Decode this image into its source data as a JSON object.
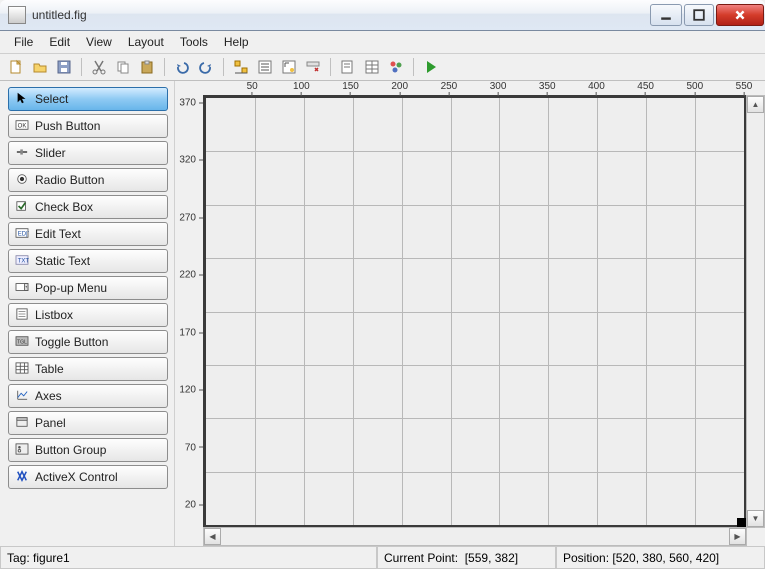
{
  "title": "untitled.fig",
  "menus": [
    "File",
    "Edit",
    "View",
    "Layout",
    "Tools",
    "Help"
  ],
  "palette": [
    {
      "label": "Select",
      "icon": "cursor",
      "selected": true
    },
    {
      "label": "Push Button",
      "icon": "ok-box",
      "selected": false
    },
    {
      "label": "Slider",
      "icon": "slider",
      "selected": false
    },
    {
      "label": "Radio Button",
      "icon": "radio",
      "selected": false
    },
    {
      "label": "Check Box",
      "icon": "checkbox",
      "selected": false
    },
    {
      "label": "Edit Text",
      "icon": "edit-text",
      "selected": false
    },
    {
      "label": "Static Text",
      "icon": "static-text",
      "selected": false
    },
    {
      "label": "Pop-up Menu",
      "icon": "popup",
      "selected": false
    },
    {
      "label": "Listbox",
      "icon": "listbox",
      "selected": false
    },
    {
      "label": "Toggle Button",
      "icon": "toggle",
      "selected": false
    },
    {
      "label": "Table",
      "icon": "table",
      "selected": false
    },
    {
      "label": "Axes",
      "icon": "axes",
      "selected": false
    },
    {
      "label": "Panel",
      "icon": "panel",
      "selected": false
    },
    {
      "label": "Button Group",
      "icon": "btn-group",
      "selected": false
    },
    {
      "label": "ActiveX Control",
      "icon": "activex",
      "selected": false
    }
  ],
  "ruler": {
    "x_ticks": [
      50,
      100,
      150,
      200,
      250,
      300,
      350,
      400,
      450,
      500,
      550
    ],
    "y_ticks": [
      20,
      70,
      120,
      170,
      220,
      270,
      320,
      370
    ]
  },
  "grid": {
    "cols": 11,
    "rows": 8
  },
  "status": {
    "tag_label": "Tag:",
    "tag_value": "figure1",
    "cp_label": "Current Point:",
    "cp_value": "[559, 382]",
    "pos_label": "Position:",
    "pos_value": "[520, 380, 560, 420]"
  },
  "colors": {
    "accent": "#2b6faa"
  }
}
